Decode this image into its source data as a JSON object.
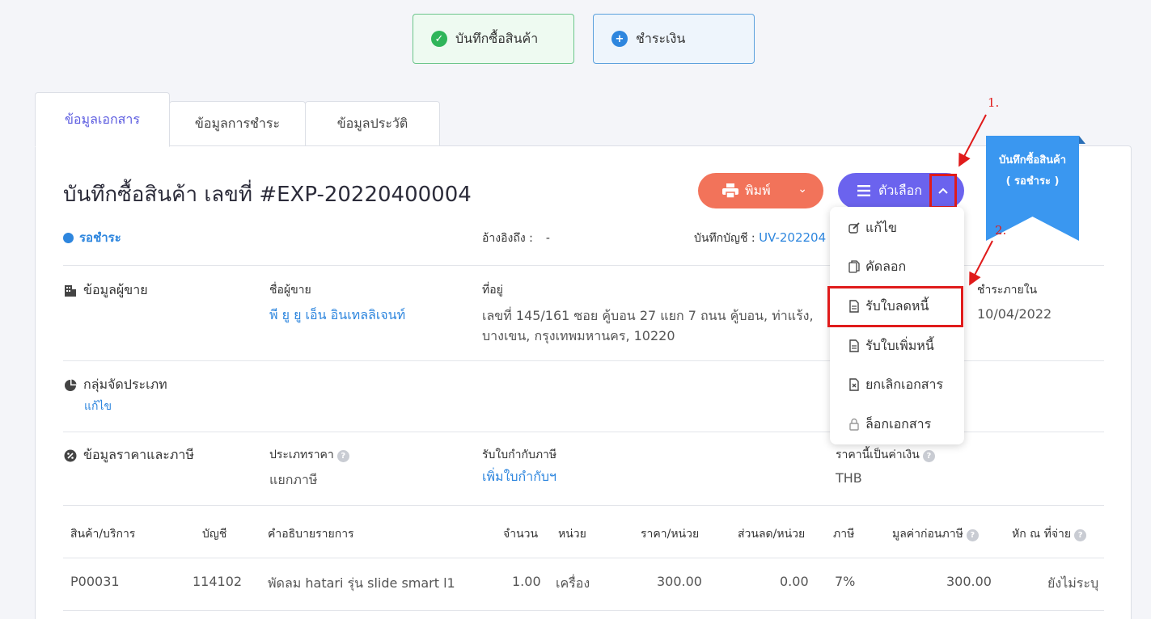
{
  "top_buttons": {
    "save_label": "บันทึกซื้อสินค้า",
    "pay_label": "ชำระเงิน"
  },
  "tabs": [
    {
      "label": "ข้อมูลเอกสาร",
      "active": true
    },
    {
      "label": "ข้อมูลการชำระ",
      "active": false
    },
    {
      "label": "ข้อมูลประวัติ",
      "active": false
    }
  ],
  "document": {
    "title": "บันทึกซื้อสินค้า เลขที่ #EXP-20220400004",
    "print_label": "พิมพ์",
    "options_label": "ตัวเลือก",
    "status": "รอชำระ",
    "ref_label": "อ้างอิงถึง :",
    "ref_value": "-",
    "account_label": "บันทึกบัญชี :",
    "account_value": "UV-202204"
  },
  "ribbon": {
    "line1": "บันทึกซื้อสินค้า",
    "line2": "( รอชำระ )"
  },
  "menu": {
    "items": [
      {
        "label": "แก้ไข",
        "icon": "edit-icon"
      },
      {
        "label": "คัดลอก",
        "icon": "copy-icon"
      },
      {
        "label": "รับใบลดหนี้",
        "icon": "document-icon"
      },
      {
        "label": "รับใบเพิ่มหนี้",
        "icon": "document-icon"
      },
      {
        "label": "ยกเลิกเอกสาร",
        "icon": "cancel-document-icon"
      },
      {
        "label": "ล็อกเอกสาร",
        "icon": "lock-icon"
      }
    ]
  },
  "annotations": {
    "step1": "1.",
    "step2": "2."
  },
  "seller": {
    "section": "ข้อมูลผู้ขาย",
    "name_label": "ชื่อผู้ขาย",
    "name": "พี ยู ยู เอ็น อินเทลลิเจนท์",
    "address_label": "ที่อยู่",
    "address_line1": "เลขที่ 145/161 ซอย คู้บอน 27 แยก 7 ถนน คู้บอน, ท่าแร้ง,",
    "address_line2": "บางเขน, กรุงเทพมหานคร, 10220",
    "due_label": "ชำระภายใน",
    "due_date": "10/04/2022"
  },
  "category": {
    "section": "กลุ่มจัดประเภท",
    "edit": "แก้ไข"
  },
  "pricing": {
    "section": "ข้อมูลราคาและภาษี",
    "price_type_label": "ประเภทราคา",
    "price_type": "แยกภาษี",
    "tax_invoice_label": "รับใบกำกับภาษี",
    "tax_invoice_link": "เพิ่มใบกำกับฯ",
    "currency_label": "ราคานี้เป็นค่าเงิน",
    "currency": "THB"
  },
  "table": {
    "headers": [
      "สินค้า/บริการ",
      "บัญชี",
      "คำอธิบายรายการ",
      "จำนวน",
      "หน่วย",
      "ราคา/หน่วย",
      "ส่วนลด/หน่วย",
      "ภาษี",
      "มูลค่าก่อนภาษี",
      "หัก ณ ที่จ่าย"
    ],
    "rows": [
      [
        "P00031",
        "114102",
        "พัดลม hatari รุ่น slide smart l1",
        "1.00",
        "เครื่อง",
        "300.00",
        "0.00",
        "7%",
        "300.00",
        "ยังไม่ระบุ"
      ]
    ]
  },
  "colors": {
    "accent": "#6b63ee",
    "print": "#f2735a",
    "link": "#2e86de",
    "highlight": "#e01b1b"
  }
}
